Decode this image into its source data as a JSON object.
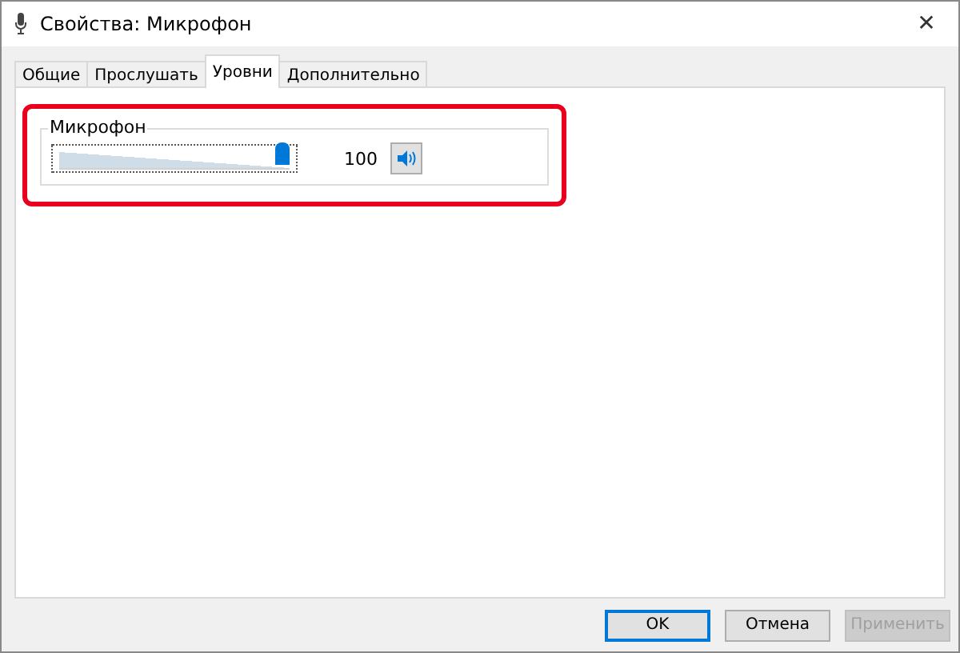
{
  "window": {
    "title": "Свойства: Микрофон",
    "close": "✕"
  },
  "tabs": [
    {
      "label": "Общие",
      "selected": false
    },
    {
      "label": "Прослушать",
      "selected": false
    },
    {
      "label": "Уровни",
      "selected": true
    },
    {
      "label": "Дополнительно",
      "selected": false
    }
  ],
  "levels": {
    "highlighted": true,
    "group_label": "Микрофон",
    "channels": [
      {
        "level": 1.0,
        "reading": "100"
      }
    ]
  },
  "buttons": [
    {
      "label": "OK",
      "default": true,
      "disabled": false
    },
    {
      "label": "Отмена",
      "default": false,
      "disabled": false
    },
    {
      "label": "Применить",
      "default": false,
      "disabled": true
    }
  ]
}
